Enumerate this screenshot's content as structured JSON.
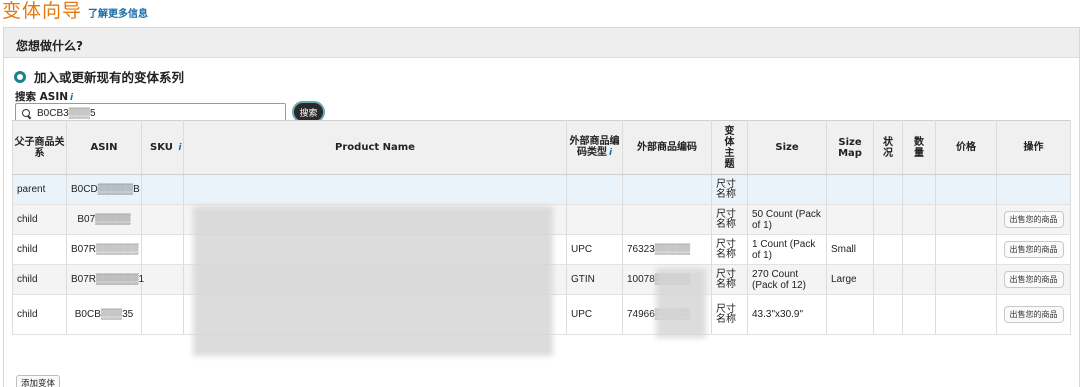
{
  "header": {
    "title": "变体向导",
    "learn_more": "了解更多信息"
  },
  "panel": {
    "question": "您想做什么?",
    "option_label": "加入或更新现有的变体系列",
    "search_label": "搜索 ASIN",
    "search_info_icon": "i",
    "search_value": "B0CB3▒▒▒5",
    "search_button": "搜索"
  },
  "table": {
    "headers": {
      "relation": "父子商品关系",
      "asin": "ASIN",
      "sku": "SKU",
      "sku_info": "i",
      "product_name": "Product Name",
      "ext_type": "外部商品编码类型",
      "ext_info": "i",
      "ext_code": "外部商品编码",
      "theme": "变体主题",
      "size": "Size",
      "size_map": "Size Map",
      "status": "状况",
      "qty": "数量",
      "price": "价格",
      "action": "操作"
    },
    "rows": [
      {
        "relation": "parent",
        "asin": "B0CD▒▒▒▒▒B",
        "ext_type": "",
        "ext_code": "",
        "theme": "尺寸名称",
        "size": "",
        "size_map": "",
        "action": ""
      },
      {
        "relation": "child",
        "asin": "B07▒▒▒▒▒",
        "ext_type": "",
        "ext_code": "",
        "theme": "尺寸名称",
        "size": "50 Count (Pack of 1)",
        "size_map": "",
        "action": "出售您的商品"
      },
      {
        "relation": "child",
        "asin": "B07R▒▒▒▒▒▒",
        "ext_type": "UPC",
        "ext_code": "76323▒▒▒▒▒",
        "theme": "尺寸名称",
        "size": "1 Count (Pack of 1)",
        "size_map": "Small",
        "action": "出售您的商品"
      },
      {
        "relation": "child",
        "asin": "B07R▒▒▒▒▒▒1",
        "ext_type": "GTIN",
        "ext_code": "10078▒▒▒▒▒",
        "theme": "尺寸名称",
        "size": "270 Count (Pack of 12)",
        "size_map": "Large",
        "action": "出售您的商品"
      },
      {
        "relation": "child",
        "asin": "B0CB▒▒▒35",
        "ext_type": "UPC",
        "ext_code": "74966▒▒▒▒▒",
        "theme": "尺寸名称",
        "size": "43.3\"x30.9\"",
        "size_map": "",
        "action": "出售您的商品"
      }
    ]
  },
  "footer": {
    "add_variation": "添加变体"
  },
  "colors": {
    "title": "#e47911",
    "link": "#1a6ea8",
    "radio": "#1d7f8c"
  }
}
